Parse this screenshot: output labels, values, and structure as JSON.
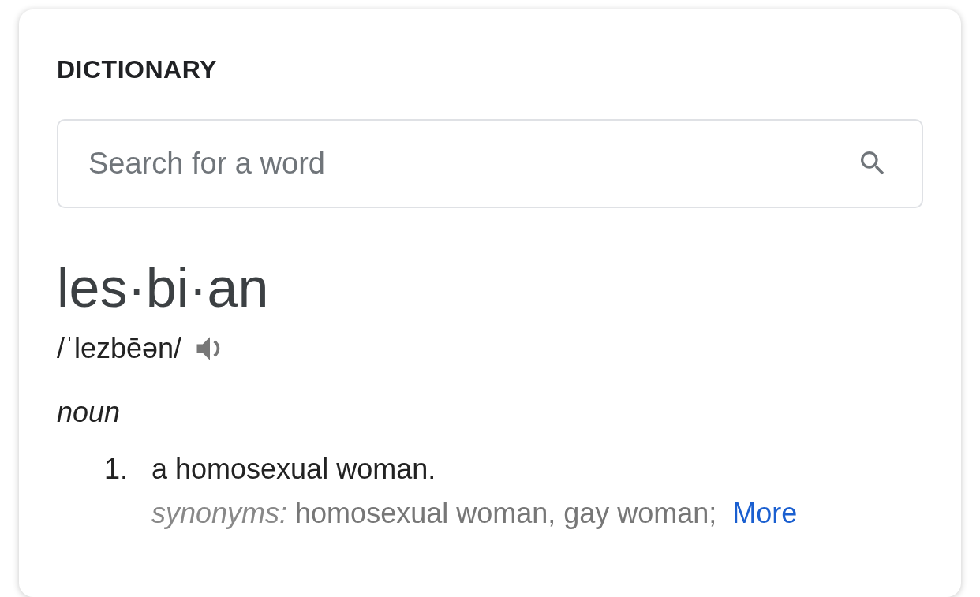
{
  "card": {
    "title": "DICTIONARY"
  },
  "search": {
    "placeholder": "Search for a word"
  },
  "entry": {
    "headword": "les·bi·an",
    "pronunciation": "/ˈlezbēən/",
    "part_of_speech": "noun",
    "senses": [
      {
        "number": "1.",
        "definition": "a homosexual woman.",
        "synonyms_label": "synonyms:",
        "synonyms": "homosexual woman, gay woman;",
        "more_link": "More"
      }
    ]
  }
}
